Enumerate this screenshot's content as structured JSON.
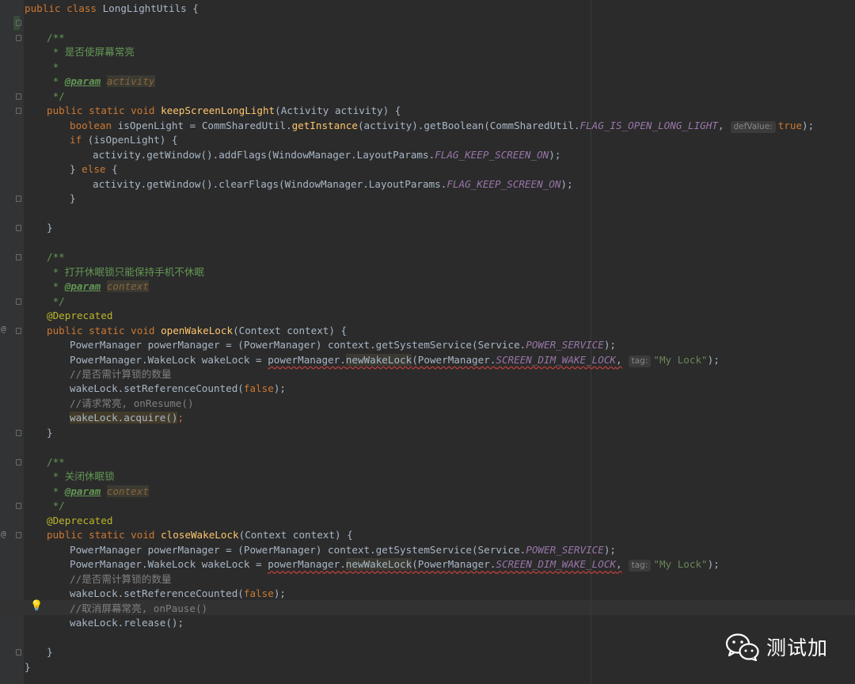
{
  "editor": {
    "lines": [
      [
        [
          "public class ",
          "kw"
        ],
        [
          "LongLightUtils {",
          ""
        ]
      ],
      [],
      [
        [
          "/**",
          "cm"
        ]
      ],
      [
        [
          " * 是否使屏幕常亮",
          "cm"
        ]
      ],
      [
        [
          " *",
          "cm"
        ]
      ],
      [
        [
          " * ",
          "cm"
        ],
        [
          "@param",
          "tg"
        ],
        [
          " ",
          ""
        ],
        [
          "activity",
          "tv hl"
        ]
      ],
      [
        [
          " */",
          "cm"
        ]
      ],
      [
        [
          "public static void ",
          "kw"
        ],
        [
          "keepScreenLongLight",
          "fn"
        ],
        [
          "(Activity activity) {",
          ""
        ]
      ],
      [
        [
          "boolean ",
          "kw"
        ],
        [
          "isOpenLight = CommSharedUtil.",
          ""
        ],
        [
          "getInstance",
          "fn"
        ],
        [
          "(activity).getBoolean(CommSharedUtil.",
          ""
        ],
        [
          "FLAG_IS_OPEN_LONG_LIGHT",
          "cn"
        ],
        [
          ",",
          ""
        ],
        [
          "defValue:",
          "hint"
        ],
        [
          "true",
          "kw"
        ],
        [
          ");",
          ""
        ]
      ],
      [
        [
          "if ",
          "kw"
        ],
        [
          "(isOpenLight) {",
          ""
        ]
      ],
      [
        [
          "activity.getWindow().addFlags(WindowManager.LayoutParams.",
          ""
        ],
        [
          "FLAG_KEEP_SCREEN_ON",
          "cn"
        ],
        [
          ");",
          ""
        ]
      ],
      [
        [
          "} ",
          ""
        ],
        [
          "else ",
          "kw"
        ],
        [
          "{",
          ""
        ]
      ],
      [
        [
          "activity.getWindow().clearFlags(WindowManager.LayoutParams.",
          ""
        ],
        [
          "FLAG_KEEP_SCREEN_ON",
          "cn"
        ],
        [
          ");",
          ""
        ]
      ],
      [
        [
          "}",
          ""
        ]
      ],
      [],
      [
        [
          "}",
          ""
        ]
      ],
      [],
      [
        [
          "/**",
          "cm"
        ]
      ],
      [
        [
          " * 打开休眠锁只能保持手机不休眠",
          "cm"
        ]
      ],
      [
        [
          " * ",
          "cm"
        ],
        [
          "@param",
          "tg"
        ],
        [
          " ",
          ""
        ],
        [
          "context",
          "tv hl"
        ]
      ],
      [
        [
          " */",
          "cm"
        ]
      ],
      [
        [
          "@Deprecated",
          "an"
        ]
      ],
      [
        [
          "public static void ",
          "kw"
        ],
        [
          "openWakeLock",
          "fn"
        ],
        [
          "(Context context) {",
          ""
        ]
      ],
      [
        [
          "PowerManager powerManager = (PowerManager) context.getSystemService(Service.",
          ""
        ],
        [
          "POWER_SERVICE",
          "cn"
        ],
        [
          ");",
          ""
        ]
      ],
      [
        [
          "PowerManager.WakeLock wakeLock = ",
          ""
        ],
        [
          "powerManager.",
          ""
        ],
        [
          "newWakeLock",
          "hl"
        ],
        [
          "(PowerManager.",
          ""
        ],
        [
          "SCREEN_DIM_WAKE_LOCK",
          "cn dep"
        ],
        [
          ",",
          ""
        ],
        [
          "tag:",
          "hint"
        ],
        [
          "\"My Lock\"",
          "st"
        ],
        [
          ");",
          ""
        ]
      ],
      [
        [
          "//是否需计算锁的数量",
          "lc"
        ]
      ],
      [
        [
          "wakeLock.setReferenceCounted(",
          ""
        ],
        [
          "false",
          "kw"
        ],
        [
          ");",
          ""
        ]
      ],
      [
        [
          "//请求常亮, onResume()",
          "lc"
        ]
      ],
      [
        [
          "wakeLock.acquire()",
          "hl2"
        ],
        [
          ";",
          "kw"
        ]
      ],
      [
        [
          "}",
          ""
        ]
      ],
      [],
      [
        [
          "/**",
          "cm"
        ]
      ],
      [
        [
          " * 关闭休眠锁",
          "cm"
        ]
      ],
      [
        [
          " * ",
          "cm"
        ],
        [
          "@param",
          "tg"
        ],
        [
          " ",
          ""
        ],
        [
          "context",
          "tv hl"
        ]
      ],
      [
        [
          " */",
          "cm"
        ]
      ],
      [
        [
          "@Deprecated",
          "an"
        ]
      ],
      [
        [
          "public static void ",
          "kw"
        ],
        [
          "closeWakeLock",
          "fn"
        ],
        [
          "(Context context) {",
          ""
        ]
      ],
      [
        [
          "PowerManager powerManager = (PowerManager) context.getSystemService(Service.",
          ""
        ],
        [
          "POWER_SERVICE",
          "cn"
        ],
        [
          ");",
          ""
        ]
      ],
      [
        [
          "PowerManager.WakeLock wakeLock = ",
          ""
        ],
        [
          "powerManager.",
          ""
        ],
        [
          "newWakeLock",
          "hl"
        ],
        [
          "(PowerManager.",
          ""
        ],
        [
          "SCREEN_DIM_WAKE_LOCK",
          "cn dep"
        ],
        [
          ",",
          ""
        ],
        [
          "tag:",
          "hint"
        ],
        [
          "\"My Lock\"",
          "st"
        ],
        [
          ");",
          ""
        ]
      ],
      [
        [
          "//是否需计算锁的数量",
          "lc"
        ]
      ],
      [
        [
          "wakeLock.setReferenceCounted(",
          ""
        ],
        [
          "false",
          "kw"
        ],
        [
          ");",
          ""
        ]
      ],
      [
        [
          "//取消屏幕常亮, onPause()",
          "lc"
        ]
      ],
      [
        [
          "wakeLock.release();",
          ""
        ]
      ],
      [],
      [
        [
          "}",
          ""
        ]
      ],
      [
        [
          "}",
          ""
        ]
      ]
    ]
  },
  "gutter": {
    "override_marker": "@",
    "bulb_icon": "lightbulb-icon"
  },
  "watermark": {
    "text": "测试加",
    "icon": "wechat-icon"
  }
}
